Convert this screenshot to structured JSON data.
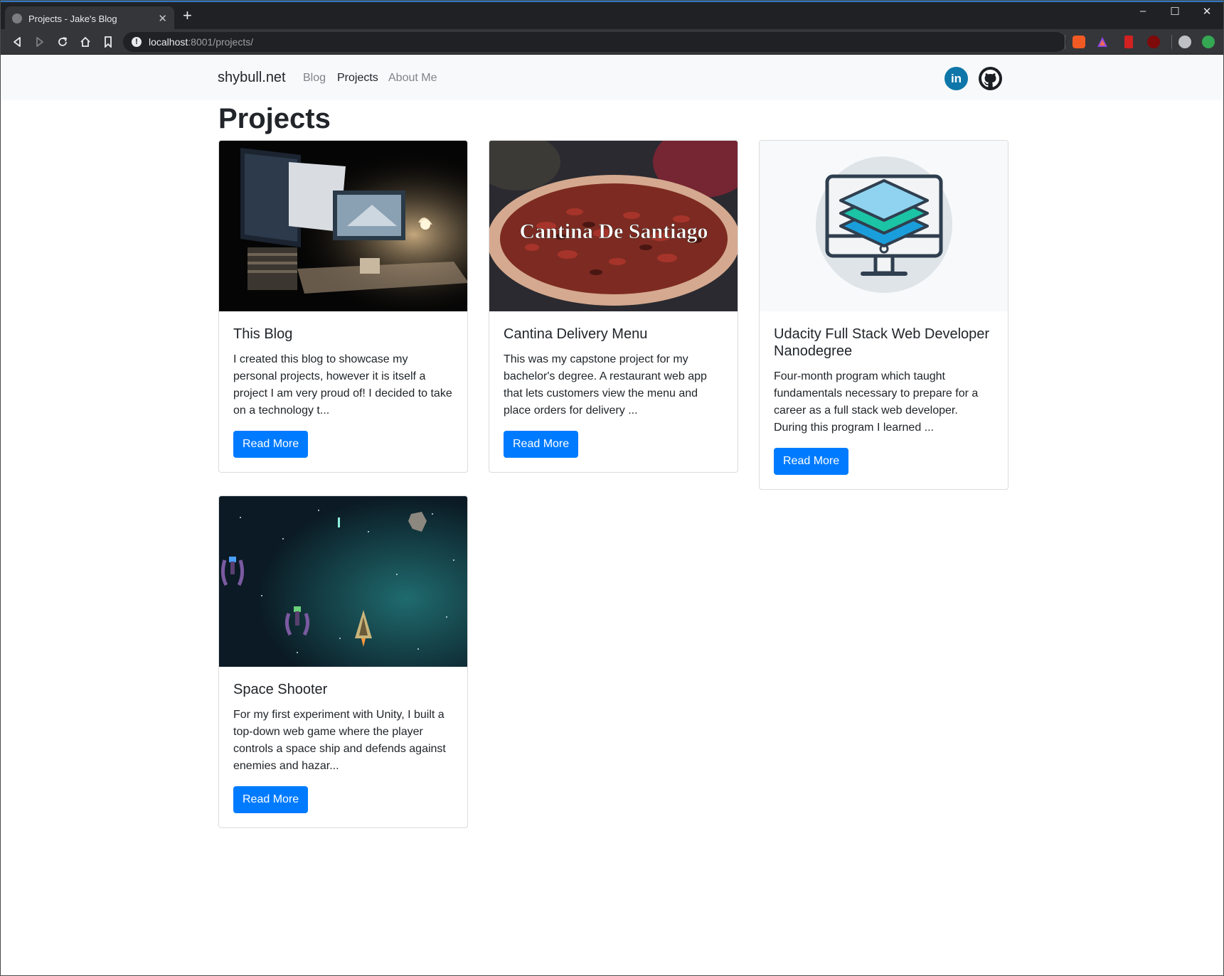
{
  "browser": {
    "tab_title": "Projects - Jake's Blog",
    "new_tab": "+",
    "close_tab": "✕",
    "url_host": "localhost",
    "url_path": ":8001/projects/",
    "window_controls": {
      "minimize": "–",
      "maximize": "☐",
      "close": "✕"
    },
    "nav": {
      "back": "◁",
      "forward": "▷",
      "reload": "↻",
      "home": "⌂",
      "bookmark": "🔖"
    }
  },
  "site": {
    "brand": "shybull.net",
    "nav": [
      {
        "label": "Blog"
      },
      {
        "label": "Projects"
      },
      {
        "label": "About Me"
      }
    ],
    "linkedin_label": "in"
  },
  "page": {
    "title": "Projects"
  },
  "cards": [
    {
      "title": "This Blog",
      "text": "I created this blog to showcase my personal projects, however it is itself a project I am very proud of! I decided to take on a technology t...",
      "button": "Read More",
      "image_caption": ""
    },
    {
      "title": "Cantina Delivery Menu",
      "text": "This was my capstone project for my bachelor's degree. A restaurant web app that lets customers view the menu and place orders for delivery ...",
      "button": "Read More",
      "image_caption": "Cantina De Santiago"
    },
    {
      "title": "Udacity Full Stack Web Developer Nanodegree",
      "text": "Four-month program which taught fundamentals necessary to prepare for a career as a full stack web developer. During this program I learned ...",
      "button": "Read More",
      "image_caption": ""
    },
    {
      "title": "Space Shooter",
      "text": "For my first experiment with Unity, I built a top-down web game where the player controls a space ship and defends against enemies and hazar...",
      "button": "Read More",
      "image_caption": ""
    }
  ],
  "colors": {
    "accent": "#007bff",
    "navbar_bg": "#f8f9fa",
    "linkedin": "#0e76a8",
    "text": "#212529"
  },
  "icons": [
    "linkedin-icon",
    "github-icon",
    "back-icon",
    "forward-icon",
    "reload-icon",
    "home-icon",
    "bookmark-icon",
    "info-icon"
  ]
}
